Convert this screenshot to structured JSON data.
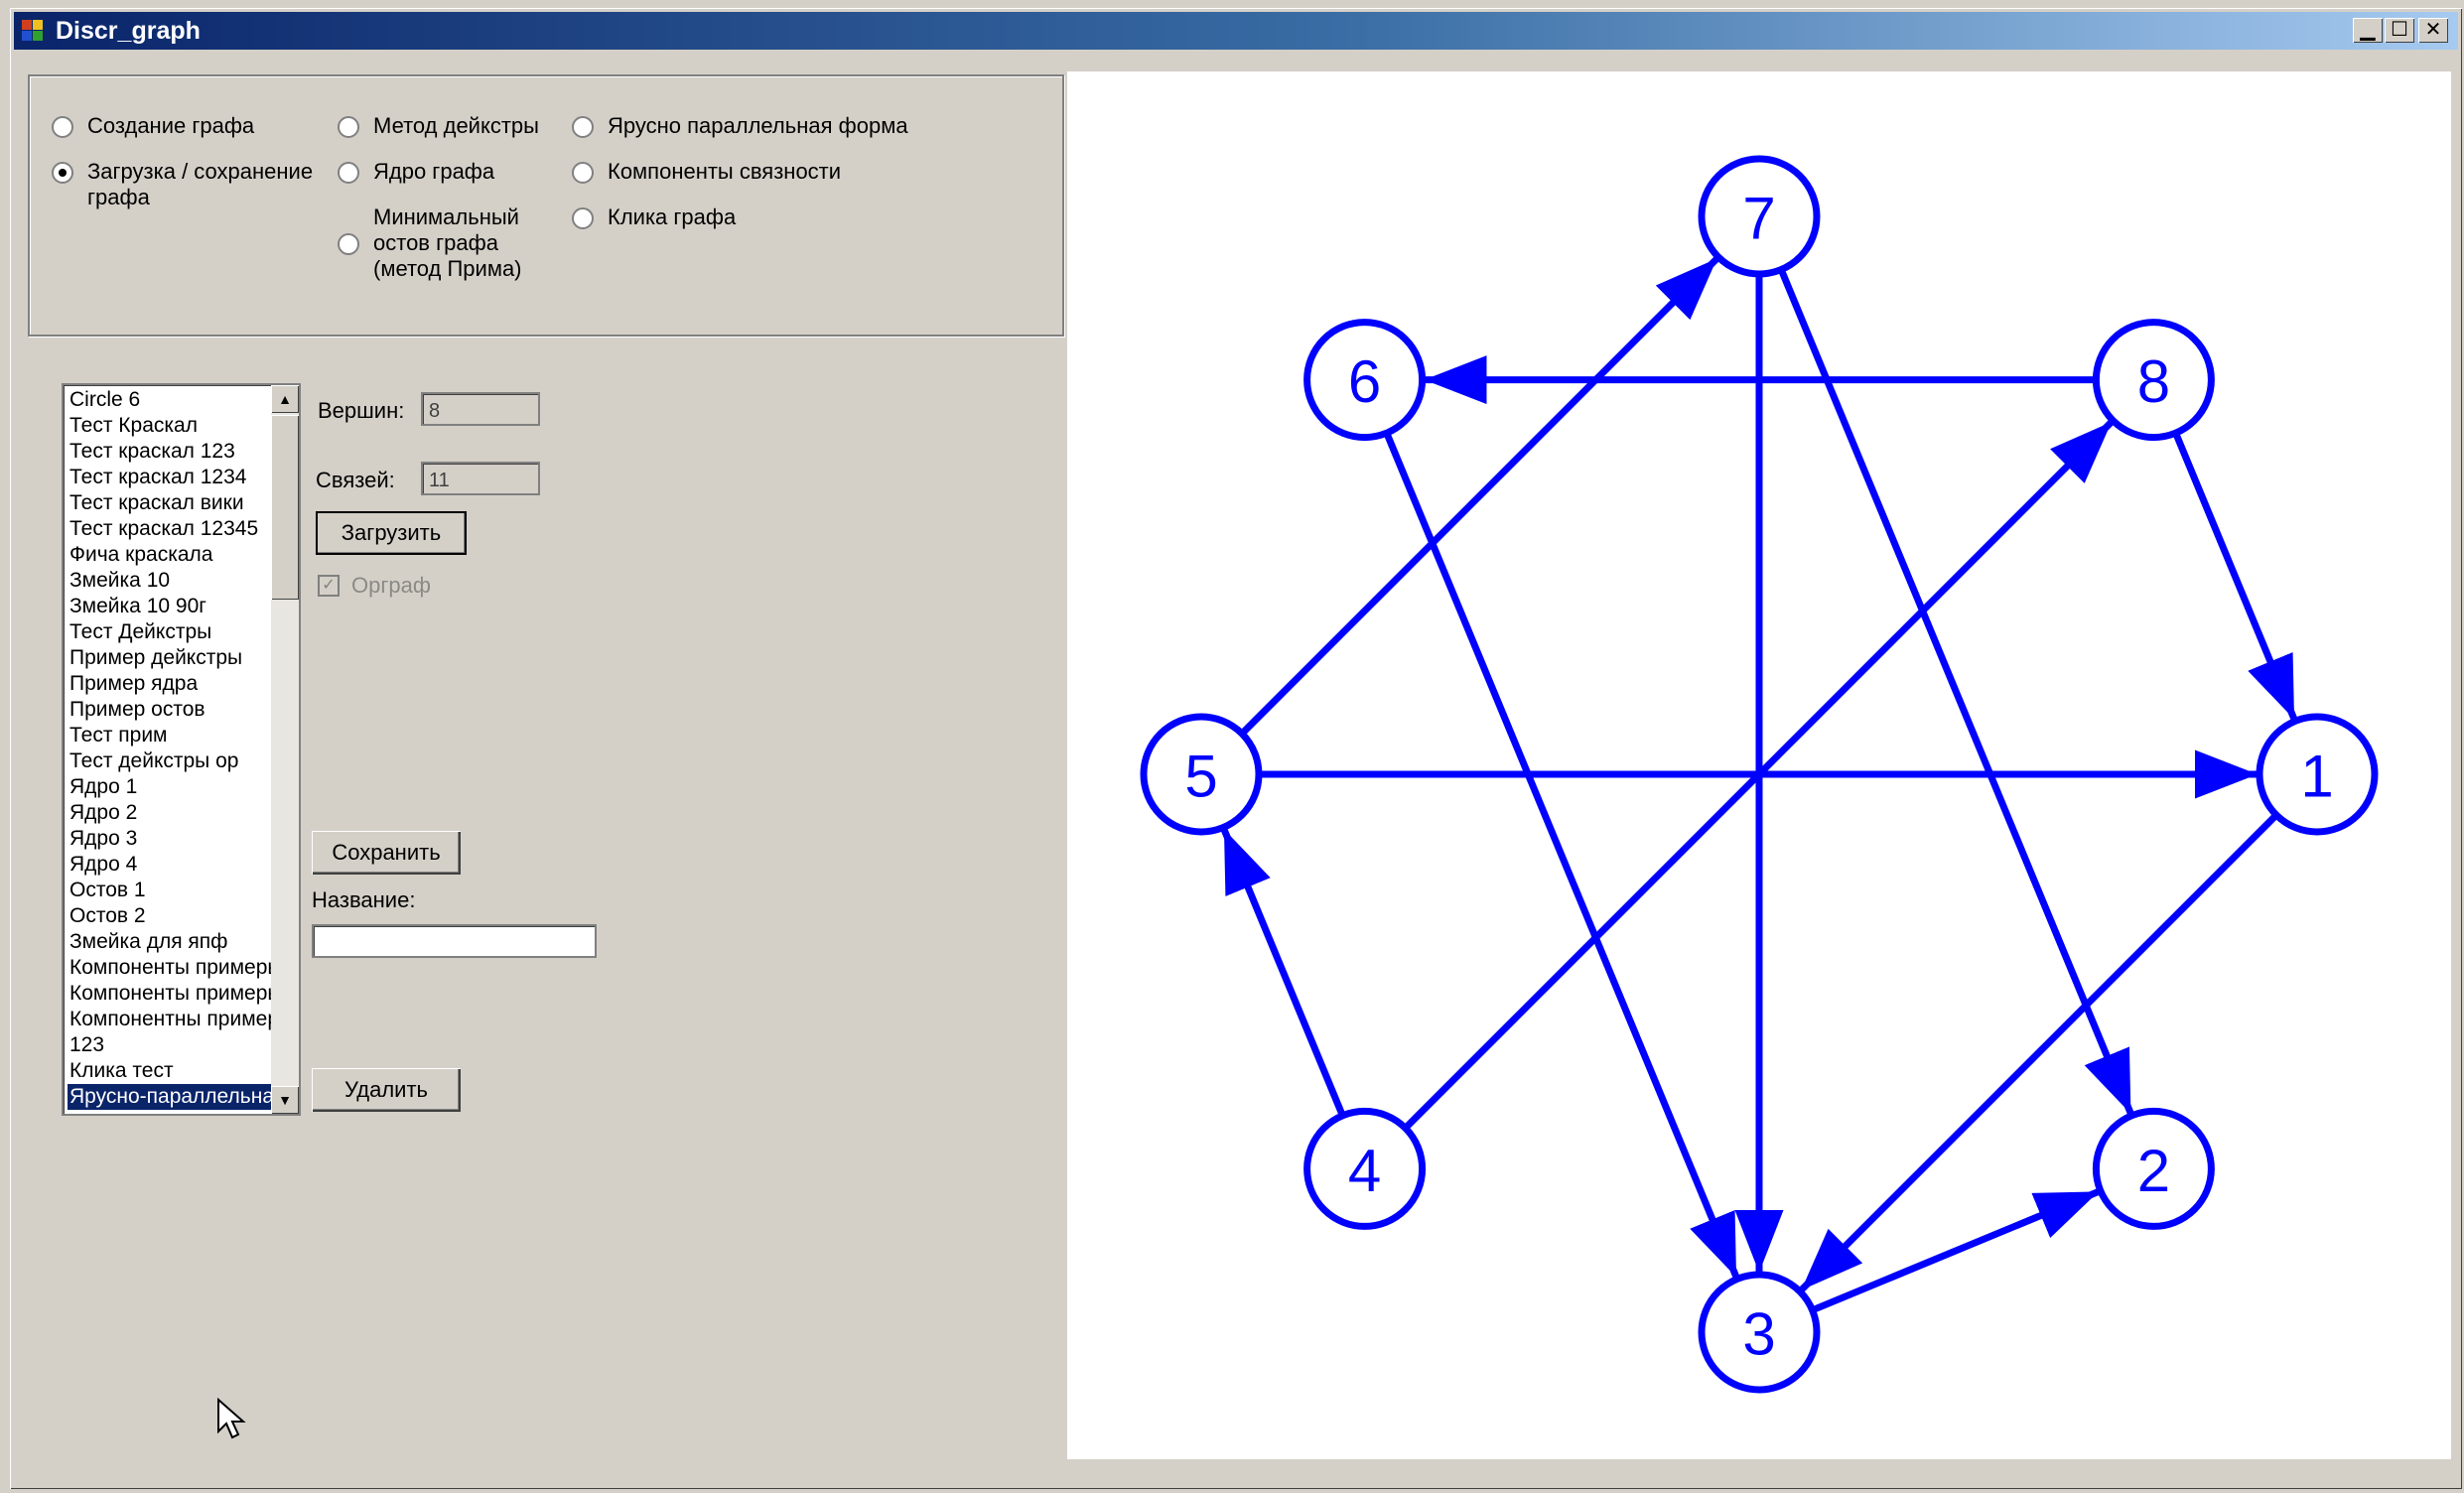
{
  "window": {
    "title": "Discr_graph",
    "controls": {
      "minimize": "▁",
      "maximize": "☐",
      "close": "✕"
    }
  },
  "modes": {
    "items": [
      {
        "label": "Создание графа",
        "checked": false
      },
      {
        "label": "Загрузка / сохранение\nграфа",
        "checked": true
      },
      {
        "label": "Метод дейкстры",
        "checked": false
      },
      {
        "label": "Ядро графа",
        "checked": false
      },
      {
        "label": "Минимальный\nостов графа\n(метод Прима)",
        "checked": false
      },
      {
        "label": "Ярусно параллельная форма",
        "checked": false
      },
      {
        "label": "Компоненты связности",
        "checked": false
      },
      {
        "label": "Клика графа",
        "checked": false
      }
    ]
  },
  "graph_list": {
    "items": [
      "Circle 6",
      "Тест Краскал",
      "Тест краскал 123",
      "Тест краскал 1234",
      "Тест краскал вики",
      "Тест краскал 12345",
      "Фича  краскала",
      "Змейка 10",
      "Змейка 10 90г",
      "Тест Дейкстры",
      "Пример дейкстры",
      "Пример ядра",
      "Пример остов",
      "Тест прим",
      "Тест дейкстры ор",
      "Ядро 1",
      "Ядро 2",
      "Ядро 3",
      "Ядро 4",
      "Остов 1",
      "Остов 2",
      "Змейка для япф",
      "Компоненты примеры",
      "Компоненты примеры",
      "Компонентны пример",
      "123",
      "Клика тест",
      "Ярусно-параллельная"
    ],
    "selected_index": 27,
    "scroll_up": "▲",
    "scroll_down": "▼"
  },
  "info": {
    "vertices_label": "Вершин:",
    "vertices_value": "8",
    "edges_label": "Связей:",
    "edges_value": "11",
    "load_button": "Загрузить",
    "digraph_label": "Орграф",
    "digraph_checked": true,
    "check_mark": "✓",
    "save_button": "Сохранить",
    "name_label": "Название:",
    "name_value": "",
    "delete_button": "Удалить"
  },
  "graph": {
    "node_color": "#0000ff",
    "nodes": [
      "1",
      "2",
      "3",
      "4",
      "5",
      "6",
      "7",
      "8"
    ],
    "edges": [
      [
        "5",
        "1"
      ],
      [
        "8",
        "1"
      ],
      [
        "8",
        "6"
      ],
      [
        "5",
        "7"
      ],
      [
        "7",
        "3"
      ],
      [
        "7",
        "2"
      ],
      [
        "6",
        "3"
      ],
      [
        "1",
        "3"
      ],
      [
        "3",
        "2"
      ],
      [
        "4",
        "5"
      ],
      [
        "4",
        "8"
      ]
    ]
  }
}
